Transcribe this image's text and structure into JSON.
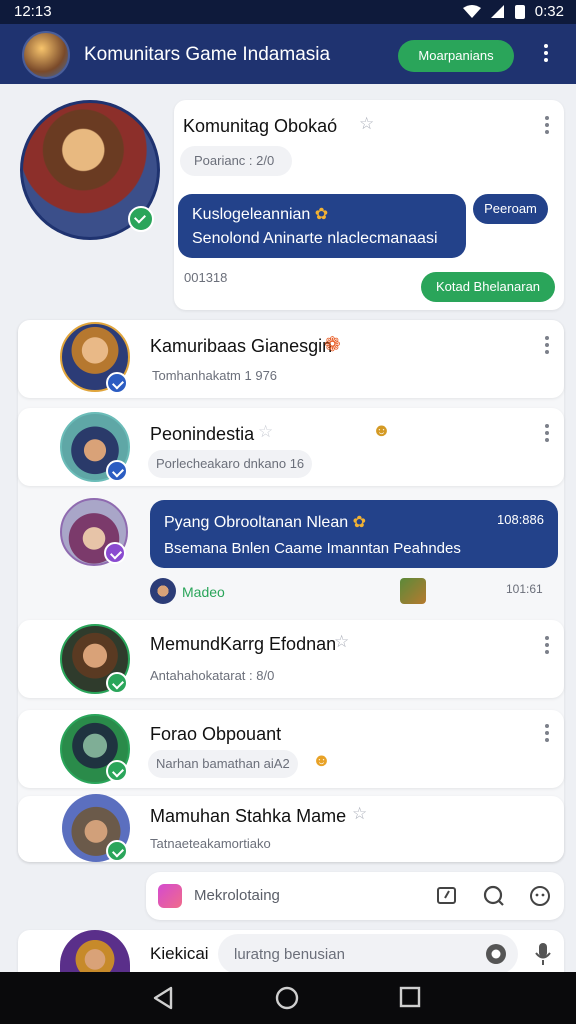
{
  "status": {
    "time": "12:13",
    "battery": "0:32"
  },
  "appbar": {
    "title": "Komunitars Game Indamasia",
    "action_label": "Moarpanians"
  },
  "featured": {
    "name": "Komunitag Obokaó",
    "pill": "Poarianc : 2/0",
    "message_line1": "Kuslogeleannian",
    "message_line2": "Senolond Aninarte nlaclecmanaasi",
    "reply_label": "Peeroam",
    "time": "001318",
    "join_label": "Kotad Bhelanaran"
  },
  "chats": [
    {
      "name": "Kamuribaas Gianesgin",
      "sub": "Tomhanhakatm 1 976"
    },
    {
      "name": "Peonindestia",
      "sub": "Porlecheakaro dnkano 16"
    },
    {
      "name": "Pyang Obrooltanan Nlean",
      "time": "108:886",
      "sub": "Bsemana Bnlen Caame Imanntan Peahndes",
      "footer_name": "Madeo",
      "footer_time": "101:61"
    },
    {
      "name": "MemundKarrg Efodnan",
      "sub": "Antahahokatarat : 8/0"
    },
    {
      "name": "Forao Obpouant",
      "sub": "Narhan bamathan aiA2"
    },
    {
      "name": "Mamuhan Stahka Mame",
      "sub": "Tatnaeteakamortiako"
    }
  ],
  "composer": {
    "placeholder": "Mekrolotaing"
  },
  "bottom": {
    "name": "Kiekicai",
    "placeholder": "luratng benusian"
  },
  "colors": {
    "appbar": "#1f3370",
    "accent_green": "#2aa55a",
    "bubble_blue": "#23428a"
  }
}
